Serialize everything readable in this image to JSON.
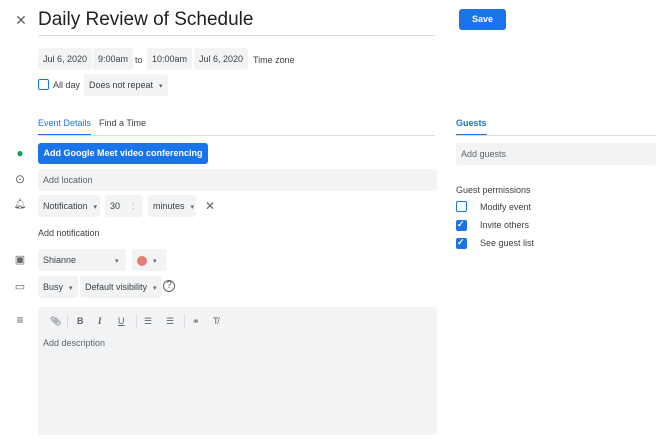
{
  "header": {
    "title": "Daily Review of Schedule",
    "save_label": "Save"
  },
  "datetime": {
    "start_date": "Jul 6, 2020",
    "start_time": "9:00am",
    "to": "to",
    "end_time": "10:00am",
    "end_date": "Jul 6, 2020",
    "timezone": "Time zone",
    "all_day": "All day",
    "repeat": "Does not repeat"
  },
  "tabs": [
    "Event Details",
    "Find a Time"
  ],
  "details": {
    "meet_button": "Add Google Meet video conferencing",
    "location_placeholder": "Add location",
    "notification_type": "Notification",
    "notification_value": "30",
    "notification_unit": "minutes",
    "add_notification": "Add notification",
    "calendar": "Shianne",
    "event_color": "#e67c73",
    "availability": "Busy",
    "visibility": "Default visibility",
    "description_placeholder": "Add description"
  },
  "toolbar": {
    "bold": "B",
    "italic": "I",
    "underline": "U"
  },
  "guests": {
    "tab": "Guests",
    "placeholder": "Add guests",
    "permissions_title": "Guest permissions",
    "permissions": [
      {
        "label": "Modify event",
        "checked": false
      },
      {
        "label": "Invite others",
        "checked": true
      },
      {
        "label": "See guest list",
        "checked": true
      }
    ]
  },
  "colors": {
    "accent": "#1a73e8"
  }
}
